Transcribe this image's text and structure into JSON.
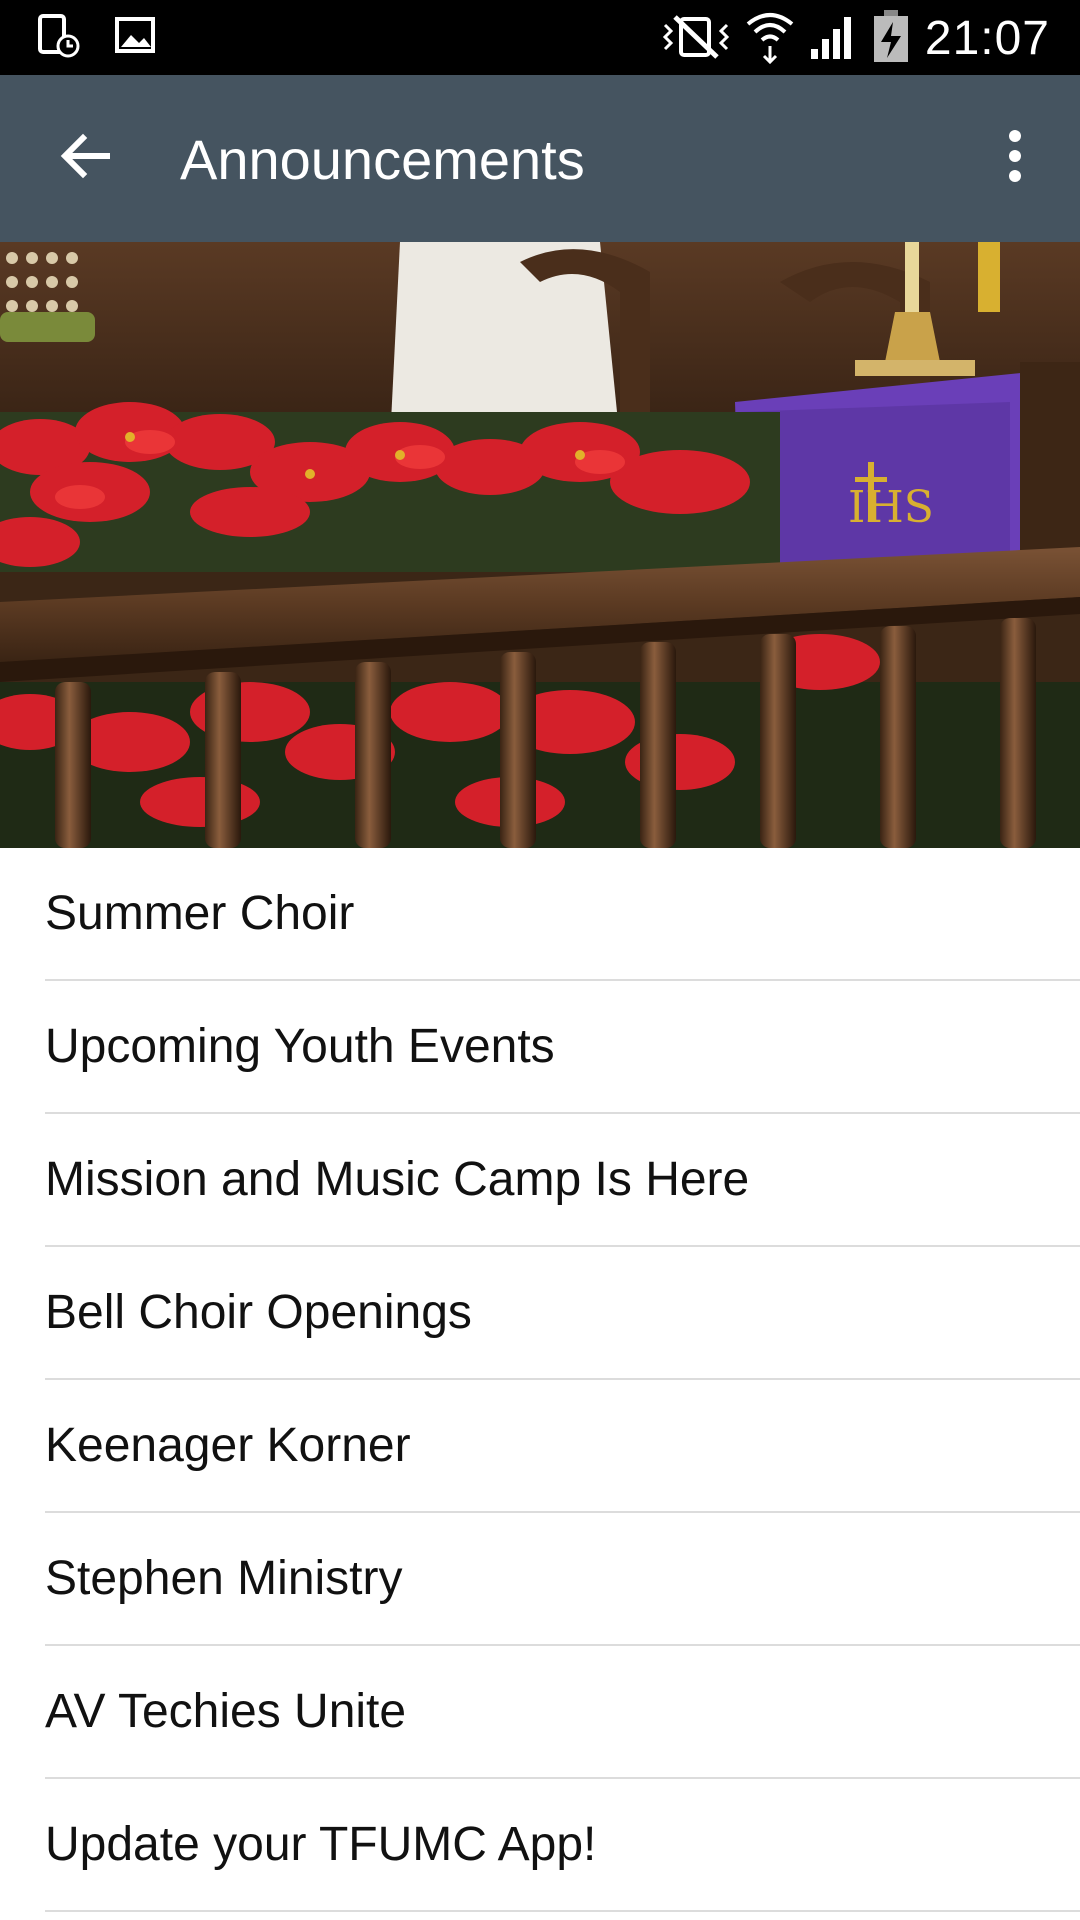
{
  "status_bar": {
    "time": "21:07",
    "left_icons": [
      "device-clock-icon",
      "image-icon"
    ],
    "right_icons": [
      "vibrate-mute-icon",
      "wifi-icon",
      "signal-icon",
      "battery-charging-icon"
    ]
  },
  "app_bar": {
    "title": "Announcements",
    "back_icon": "arrow-back-icon",
    "overflow_icon": "more-vert-icon",
    "background": "#455460"
  },
  "hero": {
    "image": "church-altar-poinsettias-photo"
  },
  "announcements": [
    {
      "label": "Summer Choir"
    },
    {
      "label": "Upcoming Youth Events"
    },
    {
      "label": "Mission and Music Camp Is Here"
    },
    {
      "label": "Bell Choir Openings"
    },
    {
      "label": "Keenager Korner"
    },
    {
      "label": "Stephen Ministry"
    },
    {
      "label": "AV Techies Unite"
    },
    {
      "label": "Update your TFUMC App!"
    }
  ]
}
